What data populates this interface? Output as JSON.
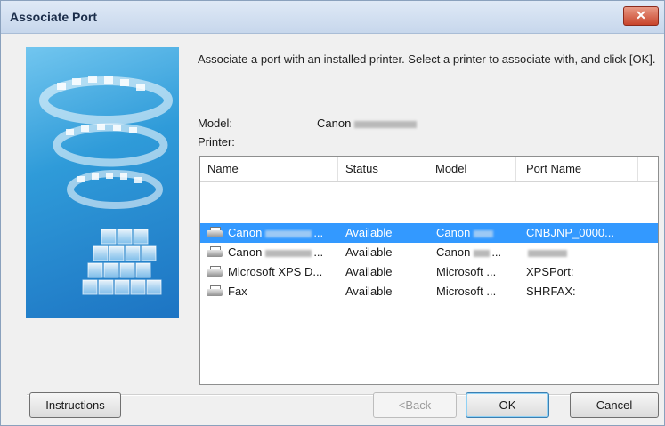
{
  "window": {
    "title": "Associate Port"
  },
  "intro_text": "Associate a port with an installed printer. Select a printer to associate with, and click [OK].",
  "model": {
    "label": "Model:",
    "value": "Canon"
  },
  "printer_label": "Printer:",
  "table": {
    "columns": [
      "Name",
      "Status",
      "Model",
      "Port Name"
    ],
    "rows": [
      {
        "name": "Canon",
        "name_suffix": "...",
        "status": "Available",
        "model": "Canon",
        "model_suffix": "",
        "port": "CNBJNP_0000...",
        "selected": true
      },
      {
        "name": "Canon",
        "name_suffix": "...",
        "status": "Available",
        "model": "Canon",
        "model_suffix": "...",
        "port": "",
        "selected": false
      },
      {
        "name": "Microsoft XPS D...",
        "name_suffix": "",
        "status": "Available",
        "model": "Microsoft ...",
        "model_suffix": "",
        "port": "XPSPort:",
        "selected": false
      },
      {
        "name": "Fax",
        "name_suffix": "",
        "status": "Available",
        "model": "Microsoft ...",
        "model_suffix": "",
        "port": "SHRFAX:",
        "selected": false
      }
    ]
  },
  "buttons": {
    "instructions": "Instructions",
    "back": "<Back",
    "ok": "OK",
    "cancel": "Cancel"
  },
  "icons": {
    "close": "close-icon",
    "printer": "printer-icon"
  },
  "colors": {
    "selection": "#3399ff",
    "title_bar": "#c7d7ec",
    "close_button": "#c8442b"
  }
}
